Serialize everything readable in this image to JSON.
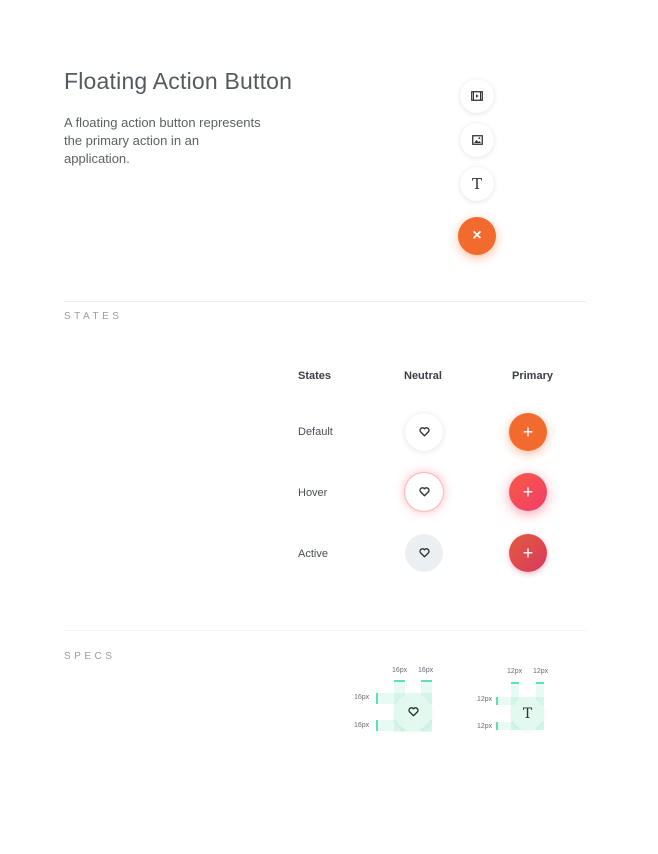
{
  "header": {
    "title": "Floating Action Button",
    "description": "A floating action button represents the primary action in an application."
  },
  "speed_dial": {
    "items": [
      {
        "icon": "video-icon"
      },
      {
        "icon": "image-icon"
      },
      {
        "icon": "text-icon",
        "glyph": "T"
      }
    ],
    "main": {
      "icon": "close-icon",
      "glyph": "×",
      "color": "#f26a2e"
    }
  },
  "states": {
    "section_label": "STATES",
    "columns": [
      "States",
      "Neutral",
      "Primary"
    ],
    "rows": [
      {
        "label": "Default"
      },
      {
        "label": "Hover"
      },
      {
        "label": "Active"
      }
    ],
    "neutral_icon": "heart-icon",
    "primary_icon": "plus-icon",
    "primary_glyph": "+",
    "colors": {
      "primary_default": "#f26a2e",
      "primary_hover": "#f2466a",
      "primary_active": "#d93a60",
      "neutral_active_bg": "#eceff2",
      "spec_accent": "#5ee0b4"
    }
  },
  "specs": {
    "section_label": "SPECS",
    "large": {
      "h1": "16px",
      "h2": "16px",
      "v1": "16px",
      "v2": "16px",
      "icon": "heart-icon"
    },
    "small": {
      "h1": "12px",
      "h2": "12px",
      "v1": "12px",
      "v2": "12px",
      "icon": "text-icon",
      "glyph": "T"
    }
  }
}
